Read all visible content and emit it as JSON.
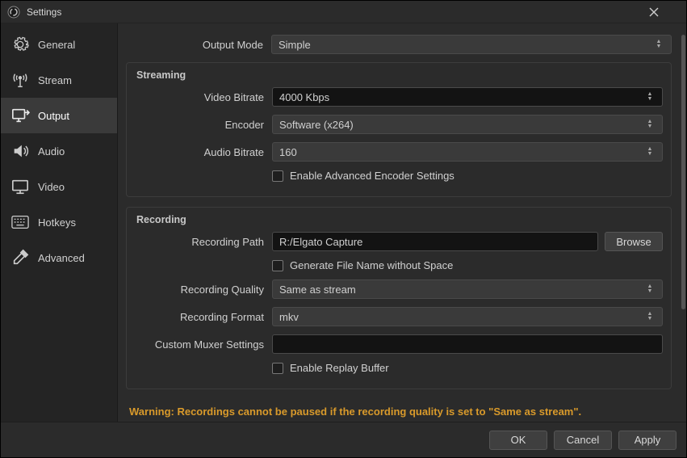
{
  "titlebar": {
    "title": "Settings"
  },
  "sidebar": {
    "items": [
      {
        "label": "General"
      },
      {
        "label": "Stream"
      },
      {
        "label": "Output"
      },
      {
        "label": "Audio"
      },
      {
        "label": "Video"
      },
      {
        "label": "Hotkeys"
      },
      {
        "label": "Advanced"
      }
    ]
  },
  "output_mode": {
    "label": "Output Mode",
    "value": "Simple"
  },
  "streaming": {
    "title": "Streaming",
    "video_bitrate": {
      "label": "Video Bitrate",
      "value": "4000 Kbps"
    },
    "encoder": {
      "label": "Encoder",
      "value": "Software (x264)"
    },
    "audio_bitrate": {
      "label": "Audio Bitrate",
      "value": "160"
    },
    "enable_advanced": {
      "label": "Enable Advanced Encoder Settings"
    }
  },
  "recording": {
    "title": "Recording",
    "path": {
      "label": "Recording Path",
      "value": "R:/Elgato Capture",
      "browse": "Browse"
    },
    "gen_no_space": {
      "label": "Generate File Name without Space"
    },
    "quality": {
      "label": "Recording Quality",
      "value": "Same as stream"
    },
    "format": {
      "label": "Recording Format",
      "value": "mkv"
    },
    "muxer": {
      "label": "Custom Muxer Settings",
      "value": ""
    },
    "replay_buffer": {
      "label": "Enable Replay Buffer"
    }
  },
  "warning": "Warning: Recordings cannot be paused if the recording quality is set to \"Same as stream\".",
  "footer": {
    "ok": "OK",
    "cancel": "Cancel",
    "apply": "Apply"
  }
}
